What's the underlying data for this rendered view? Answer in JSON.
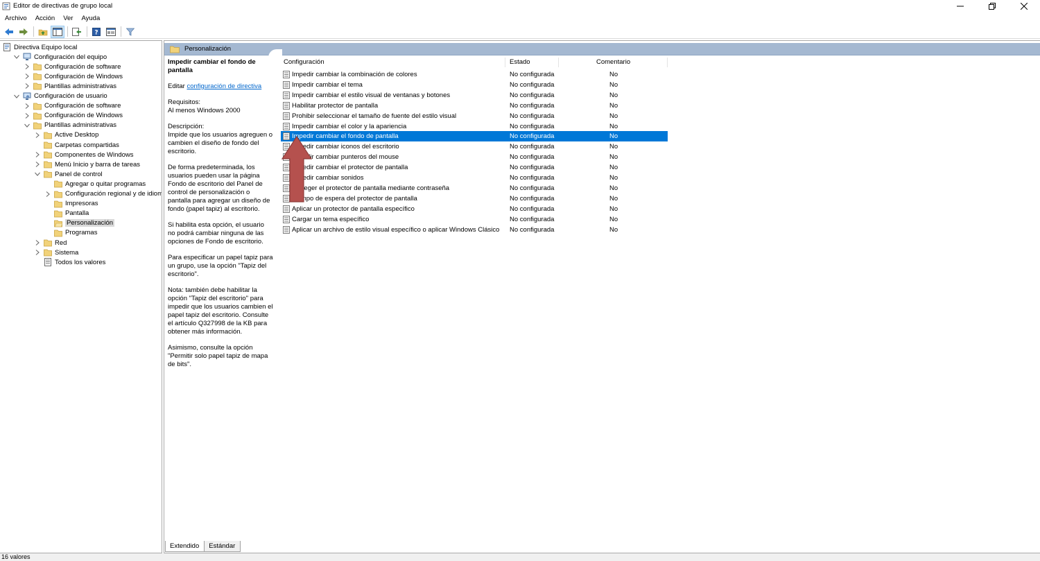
{
  "window": {
    "title": "Editor de directivas de grupo local"
  },
  "menu": [
    "Archivo",
    "Acción",
    "Ver",
    "Ayuda"
  ],
  "tree": [
    {
      "label": "Directiva Equipo local",
      "level": 0,
      "chevron": "none",
      "icon": "policy"
    },
    {
      "label": "Configuración del equipo",
      "level": 1,
      "chevron": "down",
      "icon": "computer"
    },
    {
      "label": "Configuración de software",
      "level": 2,
      "chevron": "right",
      "icon": "folder"
    },
    {
      "label": "Configuración de Windows",
      "level": 2,
      "chevron": "right",
      "icon": "folder"
    },
    {
      "label": "Plantillas administrativas",
      "level": 2,
      "chevron": "right",
      "icon": "folder"
    },
    {
      "label": "Configuración de usuario",
      "level": 1,
      "chevron": "down",
      "icon": "user"
    },
    {
      "label": "Configuración de software",
      "level": 2,
      "chevron": "right",
      "icon": "folder"
    },
    {
      "label": "Configuración de Windows",
      "level": 2,
      "chevron": "right",
      "icon": "folder"
    },
    {
      "label": "Plantillas administrativas",
      "level": 2,
      "chevron": "down",
      "icon": "folder"
    },
    {
      "label": "Active Desktop",
      "level": 3,
      "chevron": "right",
      "icon": "folder"
    },
    {
      "label": "Carpetas compartidas",
      "level": 3,
      "chevron": "none",
      "icon": "folder"
    },
    {
      "label": "Componentes de Windows",
      "level": 3,
      "chevron": "right",
      "icon": "folder"
    },
    {
      "label": "Menú Inicio y barra de tareas",
      "level": 3,
      "chevron": "right",
      "icon": "folder"
    },
    {
      "label": "Panel de control",
      "level": 3,
      "chevron": "down",
      "icon": "folder"
    },
    {
      "label": "Agregar o quitar programas",
      "level": 4,
      "chevron": "none",
      "icon": "folder"
    },
    {
      "label": "Configuración regional y de idioma",
      "level": 4,
      "chevron": "right",
      "icon": "folder"
    },
    {
      "label": "Impresoras",
      "level": 4,
      "chevron": "none",
      "icon": "folder"
    },
    {
      "label": "Pantalla",
      "level": 4,
      "chevron": "none",
      "icon": "folder"
    },
    {
      "label": "Personalización",
      "level": 4,
      "chevron": "none",
      "icon": "folder-open",
      "selected": true
    },
    {
      "label": "Programas",
      "level": 4,
      "chevron": "none",
      "icon": "folder"
    },
    {
      "label": "Red",
      "level": 3,
      "chevron": "right",
      "icon": "folder"
    },
    {
      "label": "Sistema",
      "level": 3,
      "chevron": "right",
      "icon": "folder"
    },
    {
      "label": "Todos los valores",
      "level": 3,
      "chevron": "none",
      "icon": "settings-list"
    }
  ],
  "pane": {
    "header": "Personalización"
  },
  "description": {
    "title": "Impedir cambiar el fondo de pantalla",
    "edit_prefix": "Editar",
    "edit_link": "configuración de directiva",
    "requirements_label": "Requisitos:",
    "requirements": "Al menos Windows 2000",
    "description_label": "Descripción:",
    "p1": "Impide que los usuarios agreguen o cambien el diseño de fondo del escritorio.",
    "p2": "De forma predeterminada, los usuarios pueden usar la página Fondo de escritorio del Panel de control de personalización o pantalla para agregar un diseño de fondo (papel tapiz) al escritorio.",
    "p3": "Si habilita esta opción, el usuario no podrá cambiar ninguna de las opciones de Fondo de escritorio.",
    "p4": "Para especificar un papel tapiz para un grupo, use la opción \"Tapiz del escritorio\".",
    "p5": "Nota: también debe habilitar la opción \"Tapiz del escritorio\" para impedir que los usuarios cambien el papel tapiz del escritorio. Consulte el artículo Q327998 de la KB para obtener más información.",
    "p6": "Asimismo, consulte la opción \"Permitir solo papel tapiz de mapa de bits\"."
  },
  "columns": {
    "setting": "Configuración",
    "state": "Estado",
    "comment": "Comentario"
  },
  "settings": [
    {
      "name": "Impedir cambiar la combinación de colores",
      "state": "No configurada",
      "comment": "No"
    },
    {
      "name": "Impedir cambiar el tema",
      "state": "No configurada",
      "comment": "No"
    },
    {
      "name": "Impedir cambiar el estilo visual de ventanas y botones",
      "state": "No configurada",
      "comment": "No"
    },
    {
      "name": "Habilitar protector de pantalla",
      "state": "No configurada",
      "comment": "No"
    },
    {
      "name": "Prohibir seleccionar el tamaño de fuente del estilo visual",
      "state": "No configurada",
      "comment": "No"
    },
    {
      "name": "Impedir cambiar el color y la apariencia",
      "state": "No configurada",
      "comment": "No"
    },
    {
      "name": "Impedir cambiar el fondo de pantalla",
      "state": "No configurada",
      "comment": "No",
      "selected": true
    },
    {
      "name": "Impedir cambiar iconos del escritorio",
      "state": "No configurada",
      "comment": "No"
    },
    {
      "name": "Impedir cambiar punteros del mouse",
      "state": "No configurada",
      "comment": "No"
    },
    {
      "name": "Impedir cambiar el protector de pantalla",
      "state": "No configurada",
      "comment": "No"
    },
    {
      "name": "Impedir cambiar sonidos",
      "state": "No configurada",
      "comment": "No"
    },
    {
      "name": "Proteger el protector de pantalla mediante contraseña",
      "state": "No configurada",
      "comment": "No"
    },
    {
      "name": "Tiempo de espera del protector de pantalla",
      "state": "No configurada",
      "comment": "No"
    },
    {
      "name": "Aplicar un protector de pantalla específico",
      "state": "No configurada",
      "comment": "No"
    },
    {
      "name": "Cargar un tema específico",
      "state": "No configurada",
      "comment": "No"
    },
    {
      "name": "Aplicar un archivo de estilo visual específico o aplicar Windows Clásico",
      "state": "No configurada",
      "comment": "No"
    }
  ],
  "tabs": [
    "Extendido",
    "Estándar"
  ],
  "status": "16 valores",
  "colors": {
    "selection": "#0078d7",
    "header": "#a4b8d1",
    "arrow": "#b5514e"
  }
}
